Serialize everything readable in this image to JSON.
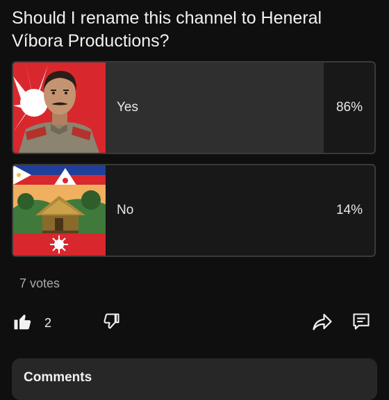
{
  "poll": {
    "question": "Should I rename this channel to Heneral Víbora Productions?",
    "options": [
      {
        "label": "Yes",
        "percent_text": "86%",
        "percent": 86,
        "thumbnail_icon": "general-portrait"
      },
      {
        "label": "No",
        "percent_text": "14%",
        "percent": 14,
        "thumbnail_icon": "nipa-hut-flag-artwork"
      }
    ],
    "votes_text": "7 votes"
  },
  "actions": {
    "like_count": "2",
    "like_icon": "thumbs-up-filled-icon",
    "dislike_icon": "thumbs-down-icon",
    "share_icon": "share-icon",
    "comment_icon": "comment-icon"
  },
  "comments": {
    "title": "Comments"
  },
  "colors": {
    "background": "#0f0f0f",
    "option_fill": "#2f2f2f",
    "option_border": "#3a3a3a",
    "text": "#f1f1f1",
    "muted_text": "#aaaaaa",
    "panel": "#272727"
  }
}
